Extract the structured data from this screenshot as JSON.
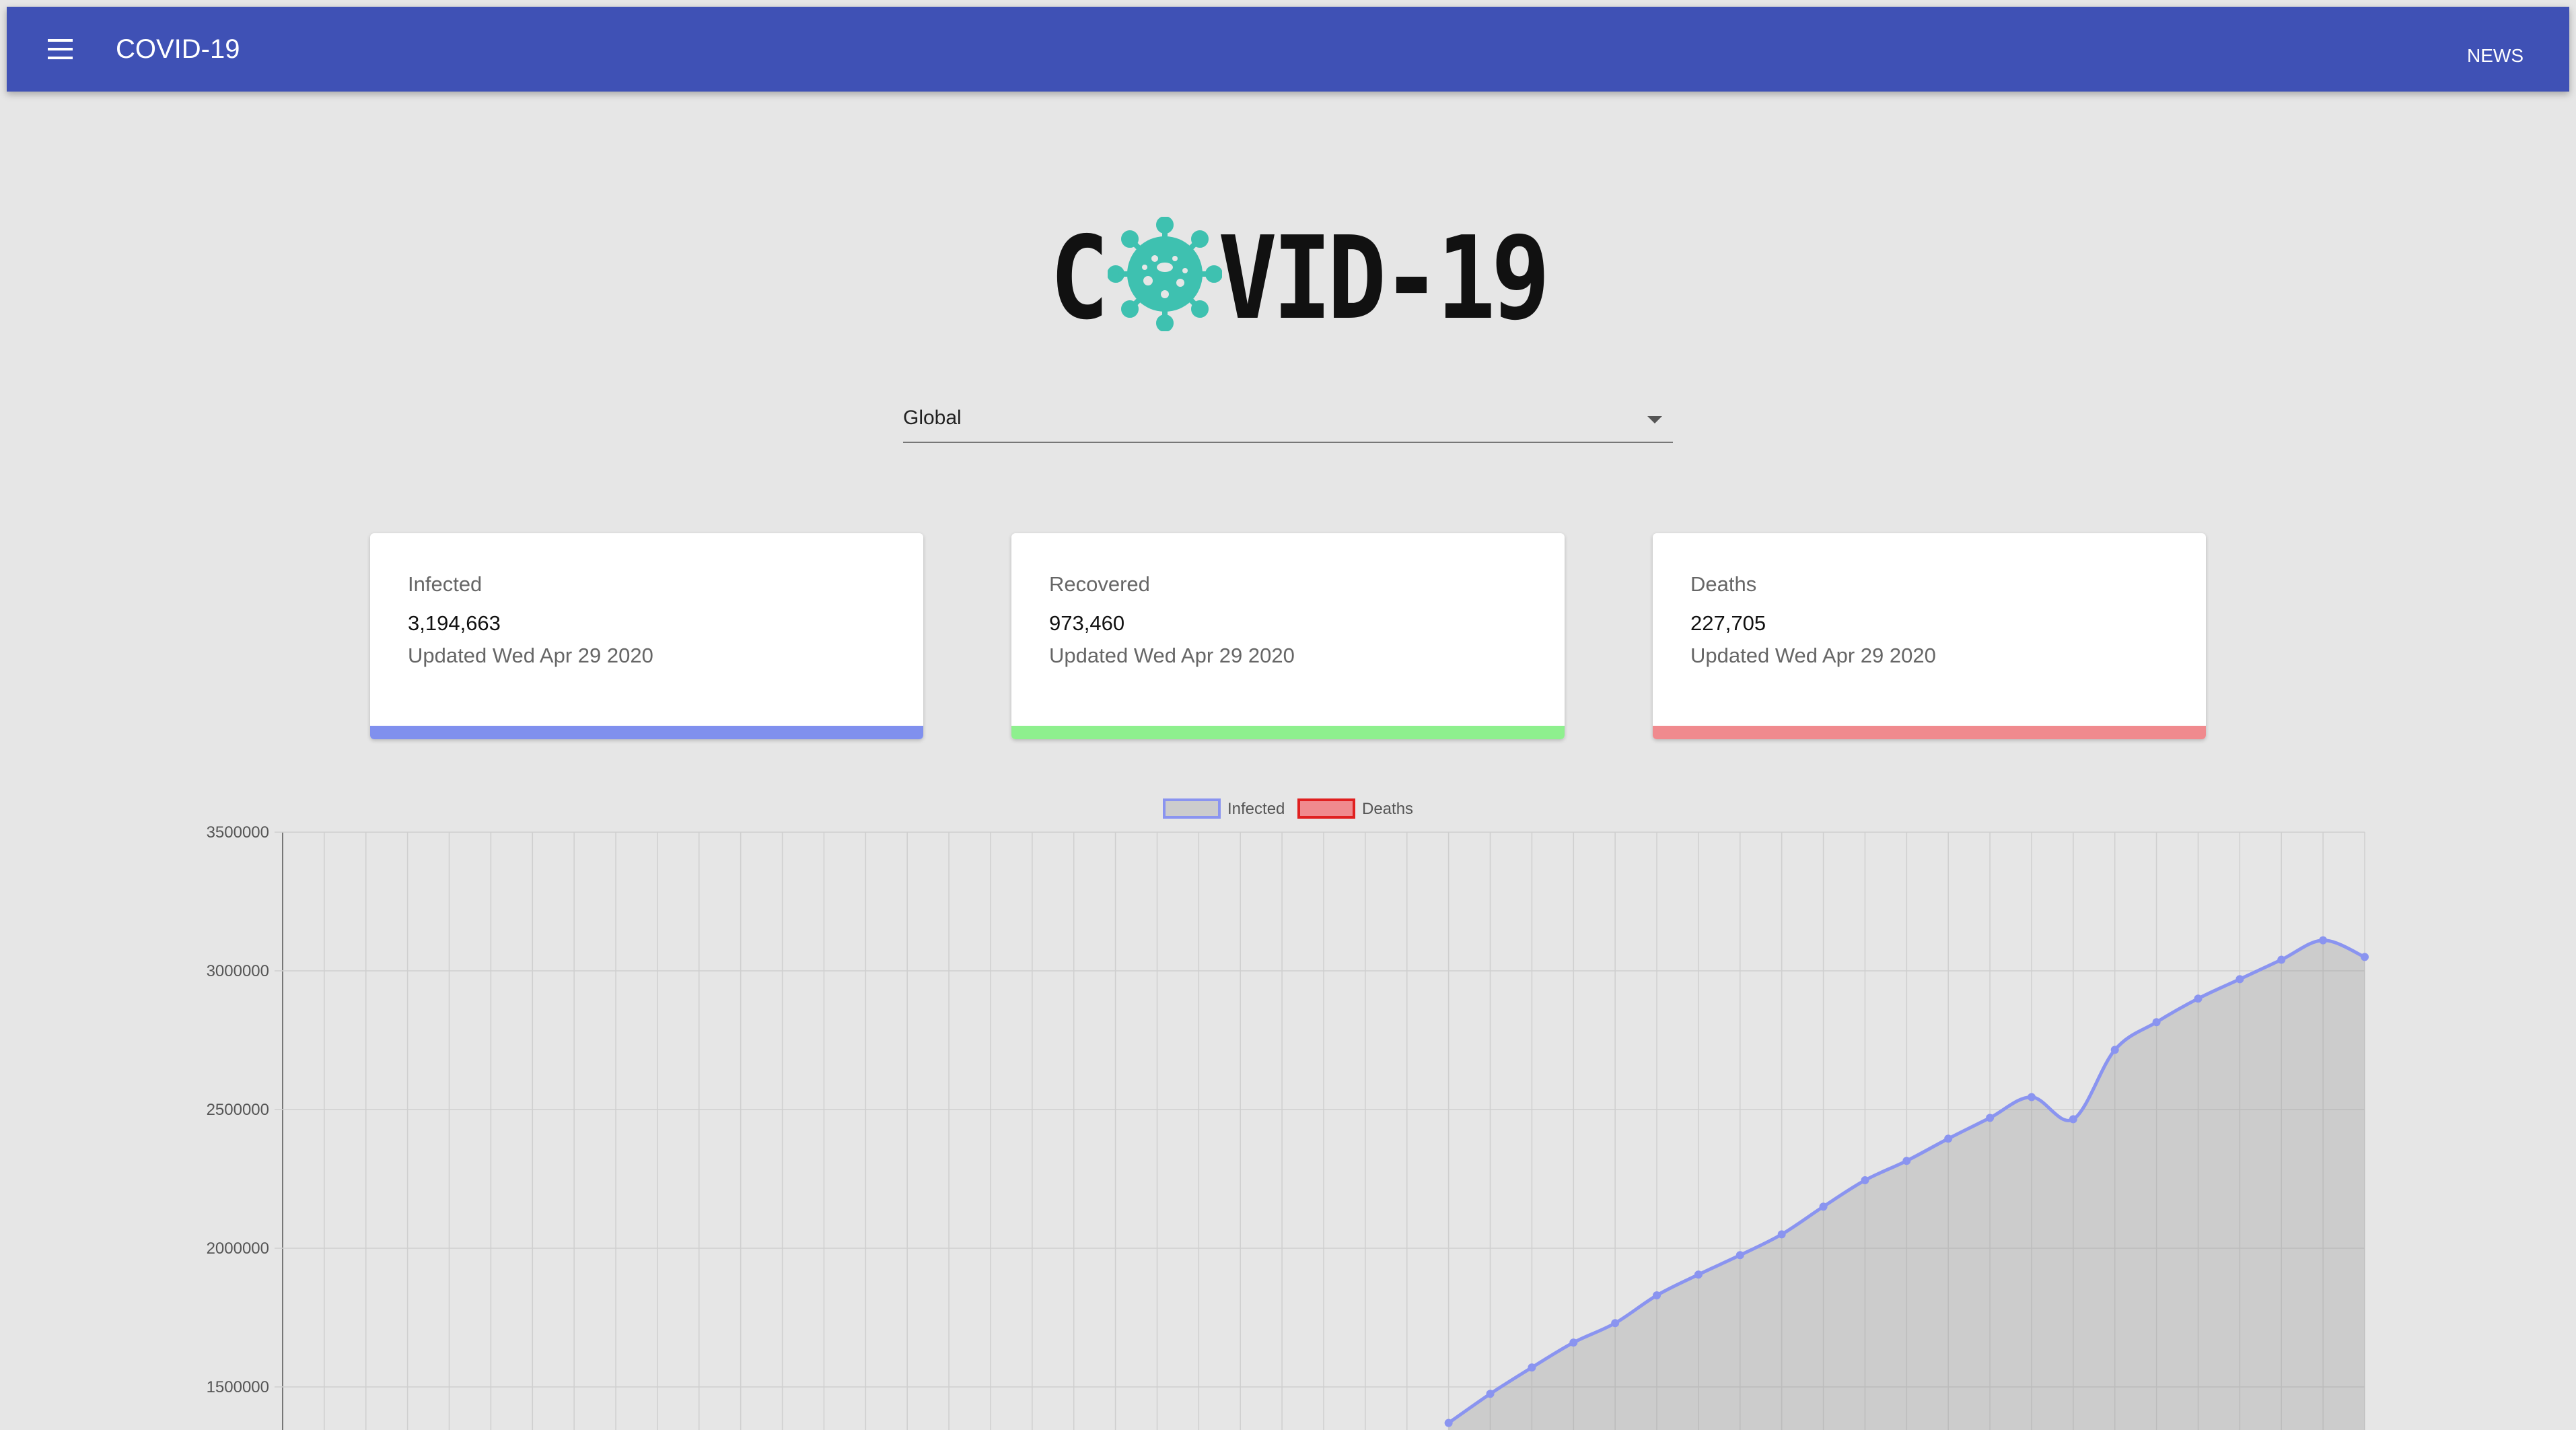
{
  "appbar": {
    "title": "COVID-19",
    "news_label": "NEWS",
    "color": "#3f51b5",
    "menu_icon": "hamburger-menu-icon"
  },
  "logo": {
    "text_left": "C",
    "text_right": "VID-19",
    "virus_icon": "virus-icon",
    "virus_color": "#3ec1b0"
  },
  "country_select": {
    "selected": "Global"
  },
  "cards": [
    {
      "label": "Infected",
      "value": "3,194,663",
      "updated": "Updated Wed Apr 29 2020",
      "color": "#8090ee"
    },
    {
      "label": "Recovered",
      "value": "973,460",
      "updated": "Updated Wed Apr 29 2020",
      "color": "#8ef08e"
    },
    {
      "label": "Deaths",
      "value": "227,705",
      "updated": "Updated Wed Apr 29 2020",
      "color": "#f08a8e"
    }
  ],
  "chart_data": {
    "type": "area",
    "legend": [
      {
        "name": "Infected",
        "fill": "#cccccc",
        "stroke": "#8a94f0"
      },
      {
        "name": "Deaths",
        "fill": "#f08a8e",
        "stroke": "#e02020"
      }
    ],
    "legend_position": "top-center",
    "grid": true,
    "ylim": [
      1300000,
      3500000
    ],
    "y_ticks": [
      "3500000",
      "3000000",
      "2500000",
      "2000000",
      "1500000"
    ],
    "x_count": 50,
    "series": [
      {
        "name": "Infected",
        "values": [
          1370000,
          1475000,
          1570000,
          1660000,
          1730000,
          1830000,
          1905000,
          1975000,
          2050000,
          2150000,
          2245000,
          2315000,
          2395000,
          2470000,
          2545000,
          2465000,
          2715000,
          2815000,
          2900000,
          2970000,
          3040000,
          3110000,
          3050000
        ]
      },
      {
        "name": "Deaths",
        "values": []
      }
    ]
  }
}
